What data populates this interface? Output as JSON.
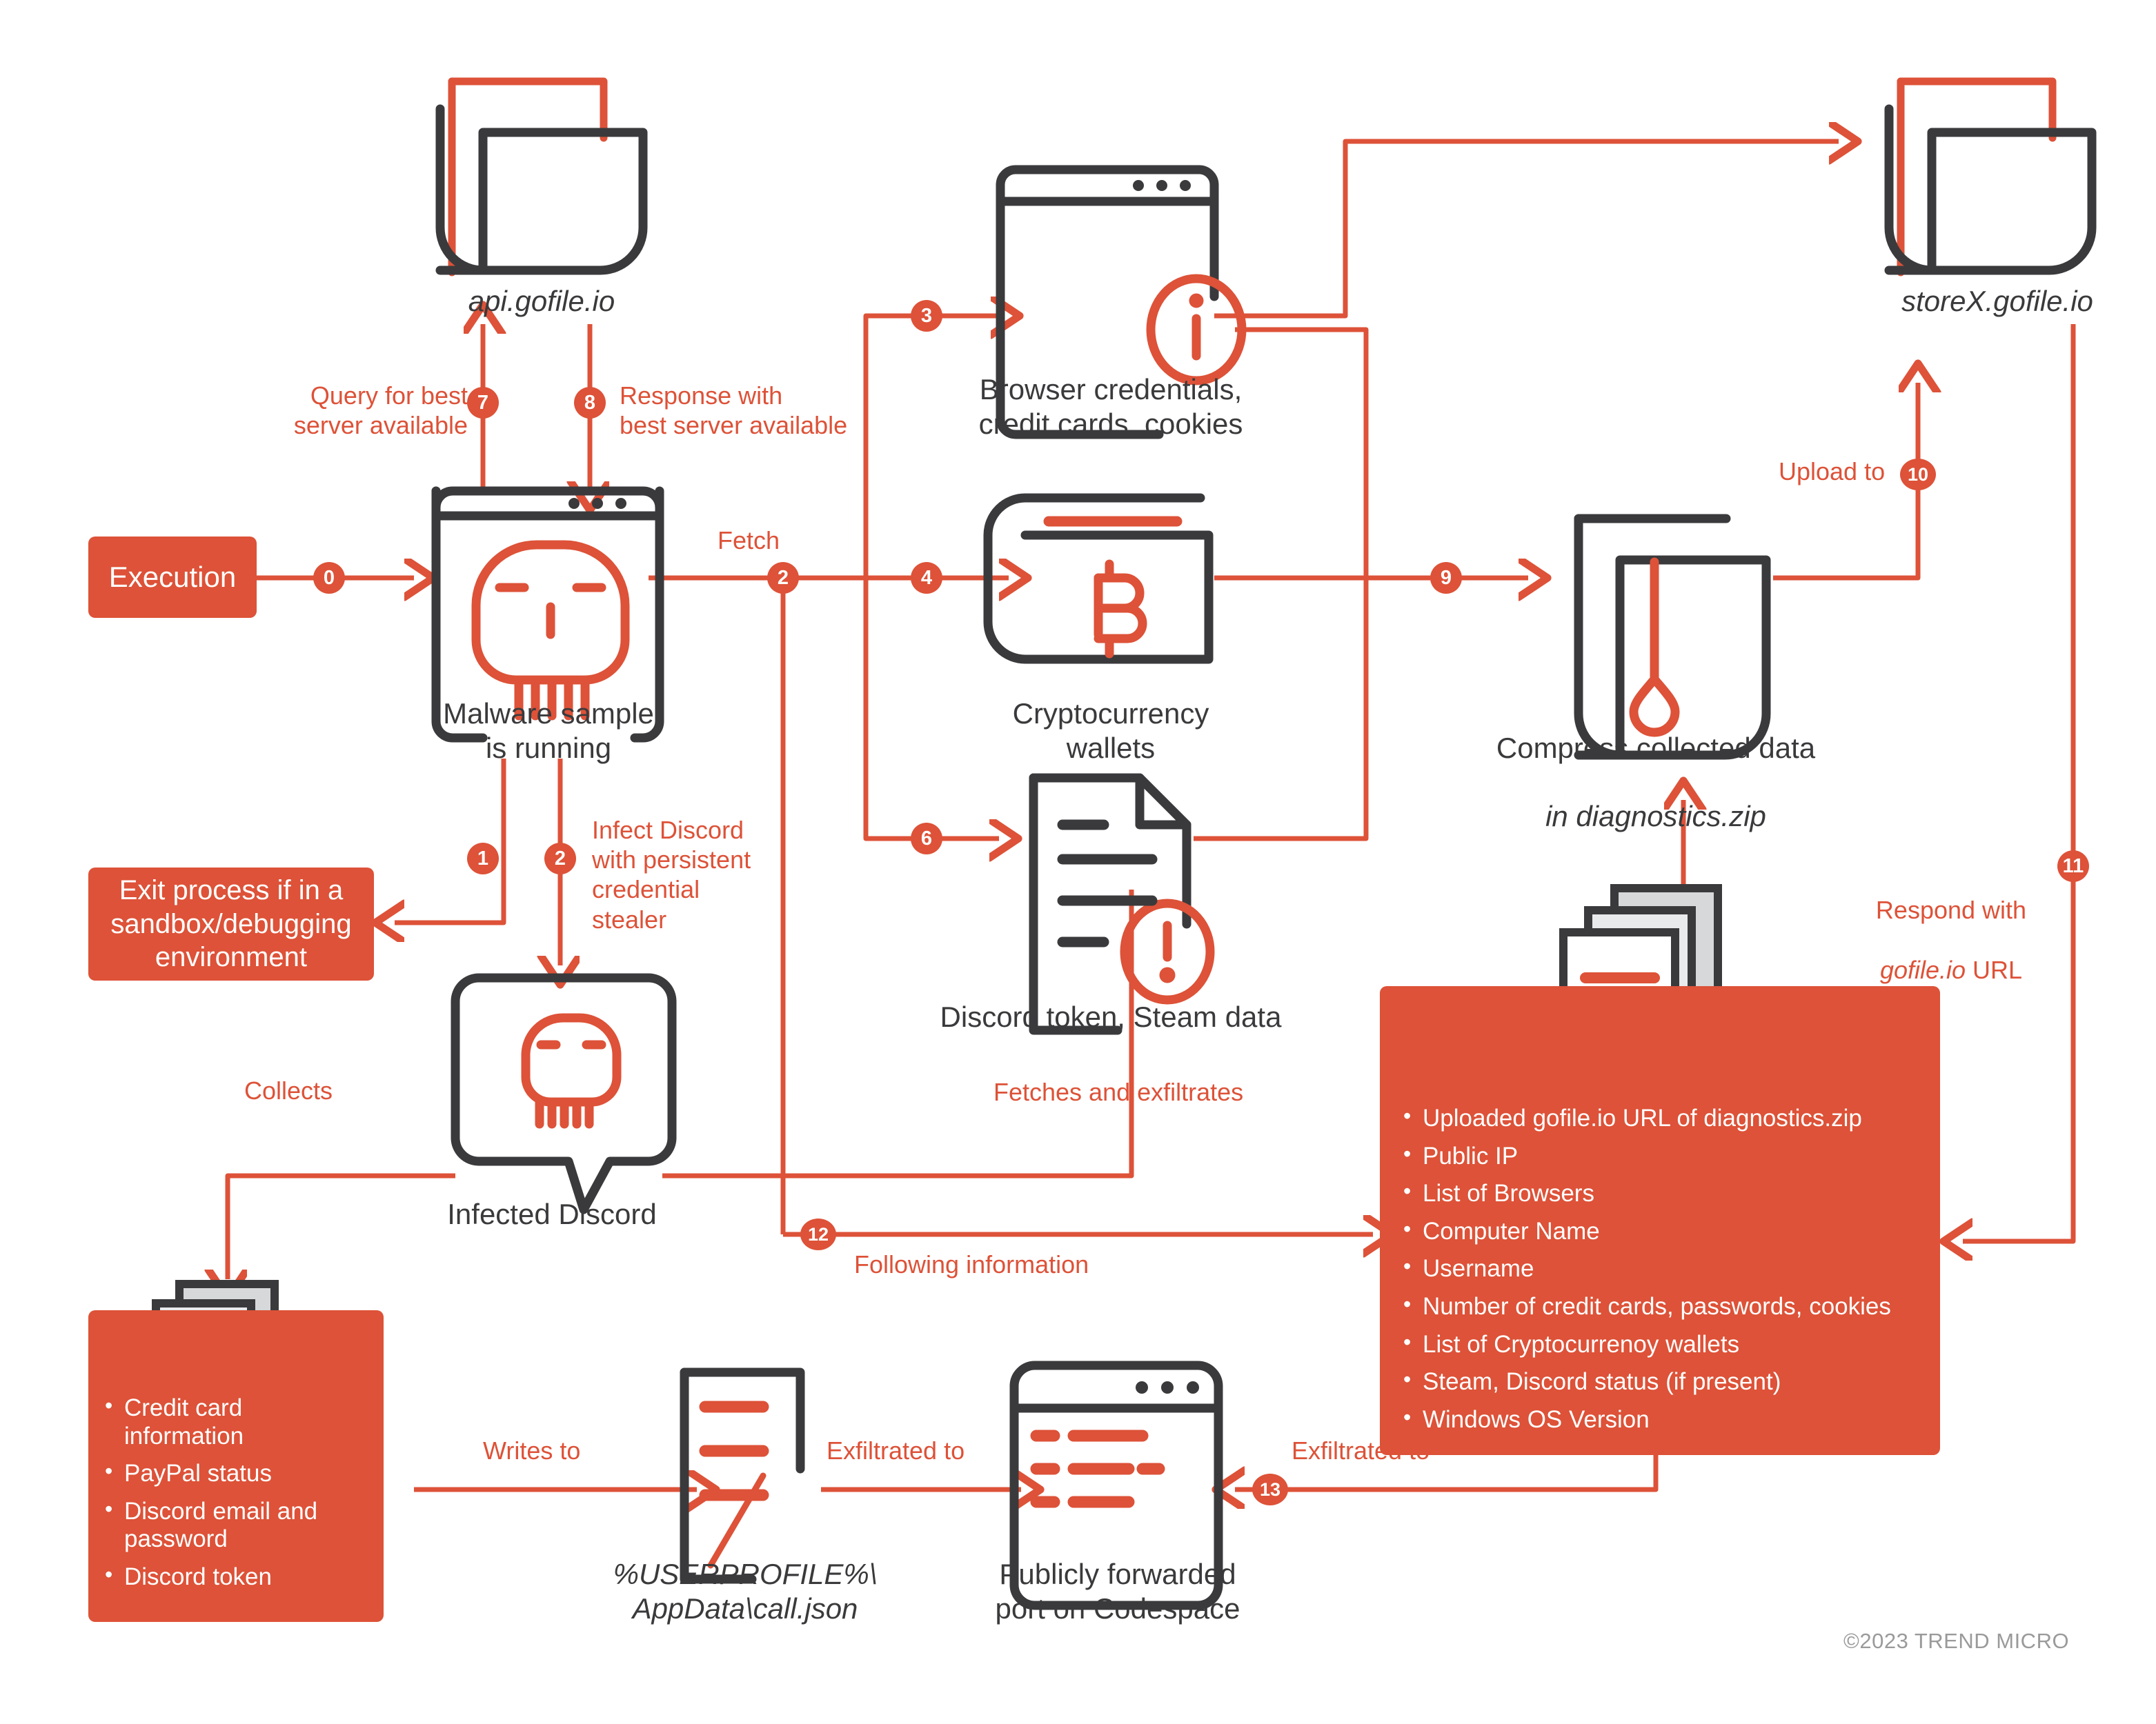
{
  "colors": {
    "accent": "#DD5238",
    "dark": "#3A3A3C",
    "paper_gray": "#D6D8D9",
    "paper_gray_light": "#E8EAEB",
    "copyright_gray": "#9A9A9A"
  },
  "nodes": {
    "api_gofile": {
      "label": "api.gofile.io",
      "icon": "cloud-server-icon"
    },
    "storex_gofile": {
      "label": "storeX.gofile.io",
      "icon": "cloud-server-icon"
    },
    "malware_sample": {
      "label": "Malware sample\nis running",
      "icon": "skull-browser-icon"
    },
    "browser_credentials": {
      "label": "Browser credentials,\ncredit cards, cookies",
      "icon": "browser-window-info-icon"
    },
    "crypto_wallets": {
      "label": "Cryptocurrency\nwallets",
      "icon": "wallet-bitcoin-icon"
    },
    "discord_steam": {
      "label": "Discord token, Steam data",
      "icon": "document-alert-icon"
    },
    "compress": {
      "label": "Compress collected data\nin diagnostics.zip",
      "label_plain": "Compress collected data",
      "label_italic": "in diagnostics.zip",
      "icon": "compress-squeeze-icon"
    },
    "infected_discord": {
      "label": "Infected Discord",
      "icon": "discord-skull-bubble-icon"
    },
    "call_json": {
      "label": "%USERPROFILE%\\\nAppData\\call.json",
      "icon": "document-lines-icon"
    },
    "codespace": {
      "label": "Publicly forwarded\nport on Codespace",
      "icon": "browser-window-lines-icon"
    }
  },
  "boxes": {
    "execution": {
      "label": "Execution"
    },
    "exit_process": {
      "label": "Exit process if in a\nsandbox/debugging\nenvironment"
    },
    "collected_left": {
      "icon": "documents-stack-icon",
      "items": [
        "Credit card information",
        "PayPal status",
        "Discord email and password",
        "Discord token"
      ]
    },
    "collected_right": {
      "icon": "documents-stack-icon",
      "items": [
        "Uploaded gofile.io URL of diagnostics.zip",
        "Public IP",
        "List of Browsers",
        "Computer Name",
        "Username",
        "Number of credit cards, passwords, cookies",
        "List of Cryptocurrenoy wallets",
        "Steam, Discord status (if present)",
        "Windows OS Version"
      ]
    }
  },
  "steps": {
    "s0": "0",
    "s1": "1",
    "s2a": "2",
    "s2b": "2",
    "s3": "3",
    "s4": "4",
    "s6": "6",
    "s7": "7",
    "s8": "8",
    "s9": "9",
    "s10": "10",
    "s11": "11",
    "s12": "12",
    "s13": "13"
  },
  "edge_labels": {
    "query_best_server": "Query for best\nserver available",
    "response_best_server": "Response with\nbest server available",
    "fetch": "Fetch",
    "infect_discord": "Infect Discord\nwith persistent\ncredential\nstealer",
    "collects": "Collects",
    "fetches_exfiltrates": "Fetches and exfiltrates",
    "following_information": "Following information",
    "upload_to": "Upload to",
    "respond_with_url_line1": "Respond with",
    "respond_with_url_line2_italic": "gofile.io",
    "respond_with_url_line2_rest": " URL",
    "writes_to": "Writes to",
    "exfiltrated_to_1": "Exfiltrated to",
    "exfiltrated_to_2": "Exfiltrated to"
  },
  "footer": {
    "copyright": "©2023 TREND MICRO"
  }
}
